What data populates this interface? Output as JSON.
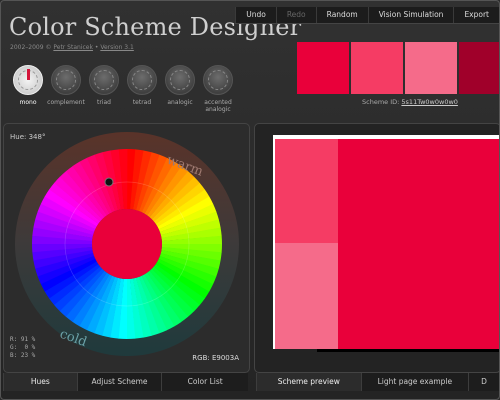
{
  "app": {
    "title": "Color Scheme Designer",
    "subtitle_prefix": "2002–2009 © ",
    "author": "Petr Stanicek",
    "version_label": "Version 3.1"
  },
  "menu": {
    "items": [
      {
        "label": "Undo",
        "enabled": true
      },
      {
        "label": "Redo",
        "enabled": false
      },
      {
        "label": "Random",
        "enabled": true
      },
      {
        "label": "Vision Simulation",
        "enabled": true
      },
      {
        "label": "Export",
        "enabled": true
      }
    ]
  },
  "modes": [
    {
      "label": "mono",
      "icon": "mono-icon",
      "active": true
    },
    {
      "label": "complement",
      "icon": "complement-icon",
      "active": false
    },
    {
      "label": "triad",
      "icon": "triad-icon",
      "active": false
    },
    {
      "label": "tetrad",
      "icon": "tetrad-icon",
      "active": false
    },
    {
      "label": "analogic",
      "icon": "analogic-icon",
      "active": false
    },
    {
      "label": "accented analogic",
      "icon": "accented-analogic-icon",
      "active": false
    }
  ],
  "swatches": [
    "#e9003a",
    "#f53c64",
    "#f56b8a",
    "#a0002a"
  ],
  "scheme": {
    "id_label": "Scheme ID:",
    "id_value": "5s11Tw0w0w0w0"
  },
  "wheel": {
    "hue_label": "Hue: 348°",
    "warm_label": "warm",
    "cold_label": "cold",
    "center_color": "#e9003a",
    "rgb_label": "RGB: E9003A",
    "r_line": "R: 91 %",
    "g_line": "G:  0 %",
    "b_line": "B: 23 %"
  },
  "left_tabs": [
    {
      "label": "Hues",
      "active": true
    },
    {
      "label": "Adjust Scheme",
      "active": false
    },
    {
      "label": "Color List",
      "active": false
    }
  ],
  "right_tabs": [
    {
      "label": "Scheme preview",
      "active": true
    },
    {
      "label": "Light page example",
      "active": false
    },
    {
      "label": "D",
      "active": false
    }
  ],
  "preview_colors": {
    "main": "#e9003a",
    "light1": "#f53c64",
    "light2": "#f56b8a"
  }
}
